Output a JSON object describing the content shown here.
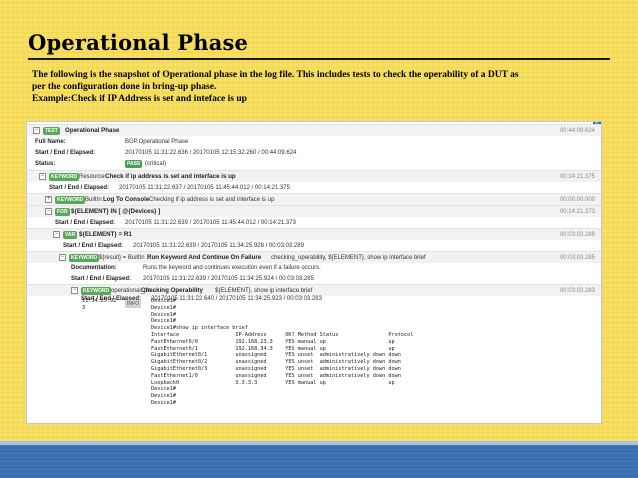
{
  "slide": {
    "title": "Operational Phase",
    "body_lines": [
      "The following is the snapshot of Operational phase in the log file. This includes tests to check the operability of a DUT as",
      "per the configuration done in bring-up phase.",
      "Example:Check if IP Address is set and inteface is up"
    ]
  },
  "log": {
    "corner": "R",
    "test": {
      "toggle": "−",
      "badge": "TEST",
      "name": "Operational Phase",
      "elapsed": "00:44:09.624",
      "full_name_label": "Full Name:",
      "full_name": "BGP.Operational Phase",
      "times_label": "Start / End / Elapsed:",
      "times": "20170105 11:31:22.636 / 20170105 12:15:32.260 / 00:44:09.624",
      "status_label": "Status:",
      "status_badge": "PASS",
      "status_extra": "(critical)"
    },
    "kw_check": {
      "toggle": "−",
      "badge": "KEYWORD",
      "prefix": "Resource .",
      "name": "Check if ip address is set and interface is up",
      "elapsed": "00:14:21.375",
      "times_label": "Start / End / Elapsed:",
      "times": "20170105 11:31:22.637 / 20170105 11:45:44.012 / 00:14:21.375"
    },
    "kw_log": {
      "toggle": "+",
      "badge": "KEYWORD",
      "prefix": "BuiltIn .",
      "name": "Log To Console",
      "args": "Checking if ip address is set and interface is up",
      "elapsed": "00:00:00.000"
    },
    "kw_for": {
      "toggle": "−",
      "badge": "FOR",
      "name": "${ELEMENT} IN [ @{Devices} ]",
      "elapsed": "00:14:21.373",
      "times_label": "Start / End / Elapsed:",
      "times": "20170105 11:31:22.639 / 20170105 11:45:44.012 / 00:14:21.373"
    },
    "kw_var": {
      "toggle": "−",
      "badge": "VAR",
      "name": "${ELEMENT} = R1",
      "elapsed": "00:03:03.289",
      "times_label": "Start / End / Elapsed:",
      "times": "20170105 11:31:22.639 / 20170105 11:34:25.928 / 00:03:03.289"
    },
    "kw_run": {
      "toggle": "−",
      "badge": "KEYWORD",
      "assign": "${result} = BuiltIn .",
      "name": "Run Keyword And Continue On Failure",
      "args": "checking_operability, ${ELEMENT}, show ip interface brief",
      "elapsed": "00:03:03.285",
      "doc_label": "Documentation:",
      "doc": "Runs the keyword and continues execution even if a failure occurs.",
      "times_label": "Start / End / Elapsed:",
      "times": "20170105 11:31:22.639 / 20170105 11:34:25.924 / 00:03:03.285"
    },
    "kw_op": {
      "toggle": "−",
      "badge": "KEYWORD",
      "prefix": "operational_ph .",
      "name": "Checking Operability",
      "args": "${ELEMENT}, show ip interface brief",
      "elapsed": "00:03:03.283",
      "times_label": "Start / End / Elapsed:",
      "times": "20170105 11:31:22.640 / 20170105 11:34:25.923 / 00:03:03.283"
    },
    "message": {
      "time_line1": "11:34:25.92",
      "time_line2": "3",
      "level": "INFO",
      "text": "Device1#\nDevice1#\nDevice1#\nDevice1#\nDevice1#show ip interface brief\nInterface                  IP-Address      OK? Method Status                Protocol\nFastEthernet0/0            192.168.23.3    YES manual up                    up\nFastEthernet0/1            192.168.34.3    YES manual up                    up\nGigabitEthernet0/1         unassigned      YES unset  administratively down down\nGigabitEthernet0/2         unassigned      YES unset  administratively down down\nGigabitEthernet0/3         unassigned      YES unset  administratively down down\nFastEthernet1/0            unassigned      YES unset  administratively down down\nLoopback0                  3.3.3.3         YES manual up                    up\nDevice1#\nDevice1#\nDevice1#"
    }
  }
}
